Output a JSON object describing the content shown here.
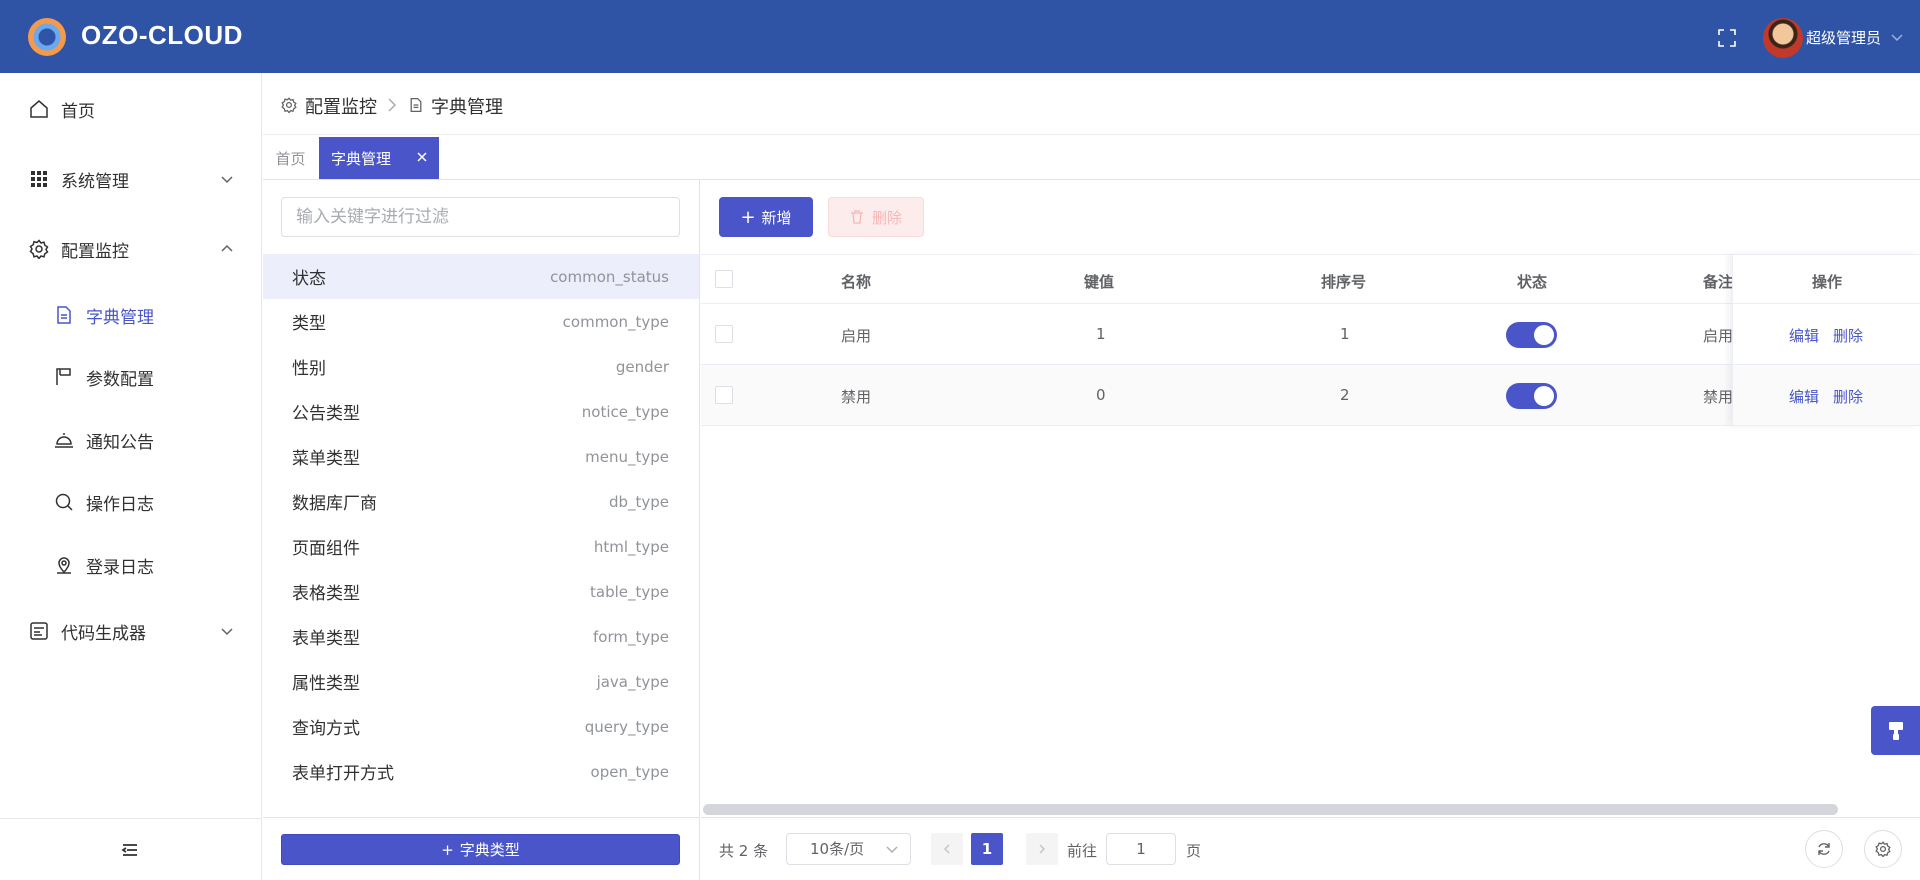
{
  "header": {
    "brand": "OZO-CLOUD",
    "username": "超级管理员"
  },
  "sidebar": {
    "home": "首页",
    "system": "系统管理",
    "config": "配置监控",
    "sub": [
      "字典管理",
      "参数配置",
      "通知公告",
      "操作日志",
      "登录日志"
    ],
    "codegen": "代码生成器"
  },
  "breadcrumb": [
    "配置监控",
    "字典管理"
  ],
  "tabs": {
    "home": "首页",
    "active": "字典管理"
  },
  "dict": {
    "placeholder": "输入关键字进行过滤",
    "items": [
      {
        "name": "状态",
        "code": "common_status"
      },
      {
        "name": "类型",
        "code": "common_type"
      },
      {
        "name": "性别",
        "code": "gender"
      },
      {
        "name": "公告类型",
        "code": "notice_type"
      },
      {
        "name": "菜单类型",
        "code": "menu_type"
      },
      {
        "name": "数据库厂商",
        "code": "db_type"
      },
      {
        "name": "页面组件",
        "code": "html_type"
      },
      {
        "name": "表格类型",
        "code": "table_type"
      },
      {
        "name": "表单类型",
        "code": "form_type"
      },
      {
        "name": "属性类型",
        "code": "java_type"
      },
      {
        "name": "查询方式",
        "code": "query_type"
      },
      {
        "name": "表单打开方式",
        "code": "open_type"
      }
    ],
    "add_button": "字典类型"
  },
  "toolbar": {
    "add": "新增",
    "delete": "删除"
  },
  "table": {
    "headers": {
      "name": "名称",
      "key": "键值",
      "sort": "排序号",
      "status": "状态",
      "remark": "备注",
      "ops": "操作"
    },
    "rows": [
      {
        "name": "启用",
        "key": "1",
        "sort": "1",
        "status_on": true,
        "remark": "启用"
      },
      {
        "name": "禁用",
        "key": "0",
        "sort": "2",
        "status_on": true,
        "remark": "禁用"
      }
    ],
    "edit": "编辑",
    "del": "删除"
  },
  "pager": {
    "total": "共 2 条",
    "size": "10条/页",
    "current": "1",
    "goto": "前往",
    "goto_value": "1",
    "page_suffix": "页"
  },
  "colors": {
    "primary": "#4955c8",
    "header": "#2f54a5"
  }
}
